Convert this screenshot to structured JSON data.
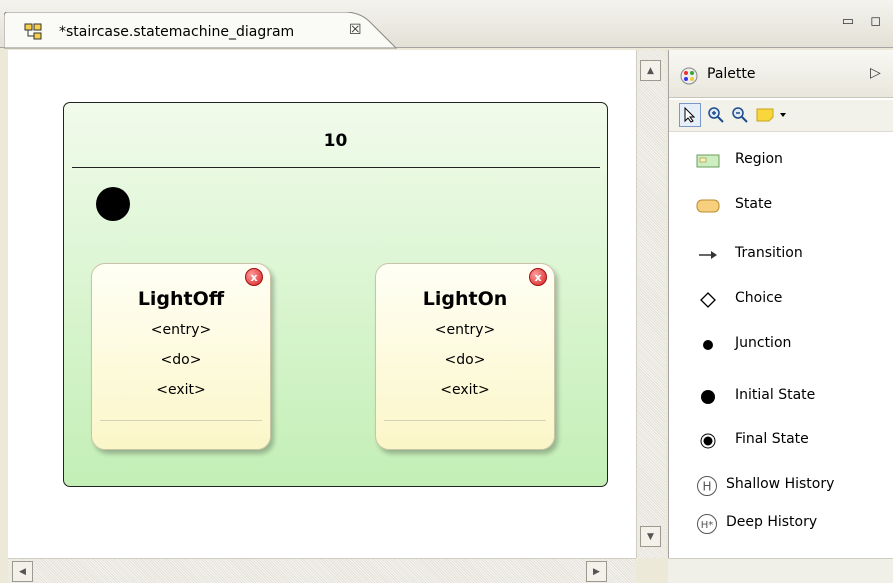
{
  "editor": {
    "tab_title": "*staircase.statemachine_diagram",
    "close_glyph": "☒",
    "window_controls": "▭ ◻"
  },
  "diagram": {
    "region_title": "10",
    "states": [
      {
        "name": "LightOff",
        "entry": "<entry>",
        "do": "<do>",
        "exit": "<exit>"
      },
      {
        "name": "LightOn",
        "entry": "<entry>",
        "do": "<do>",
        "exit": "<exit>"
      }
    ],
    "delete_glyph": "x"
  },
  "palette": {
    "title": "Palette",
    "collapse_glyph": "▷",
    "tools": [
      "select-tool",
      "zoom-in-tool",
      "zoom-out-tool",
      "note-tool"
    ],
    "items": [
      {
        "label": "Region",
        "icon": "region-icon"
      },
      {
        "label": "State",
        "icon": "state-icon"
      },
      {
        "label": "Transition",
        "icon": "transition-icon"
      },
      {
        "label": "Choice",
        "icon": "choice-icon"
      },
      {
        "label": "Junction",
        "icon": "junction-icon"
      },
      {
        "label": "Initial State",
        "icon": "initial-state-icon"
      },
      {
        "label": "Final State",
        "icon": "final-state-icon"
      },
      {
        "label": "Shallow History",
        "icon": "shallow-history-icon",
        "icon_text": "H"
      },
      {
        "label": "Deep History",
        "icon": "deep-history-icon",
        "icon_text": "H*"
      }
    ]
  },
  "colors": {
    "region_top": "#f1fbeb",
    "region_bottom": "#c3efb6",
    "state_top": "#fffff5",
    "state_bottom": "#fbf6c8",
    "delete_badge": "#d62020"
  }
}
